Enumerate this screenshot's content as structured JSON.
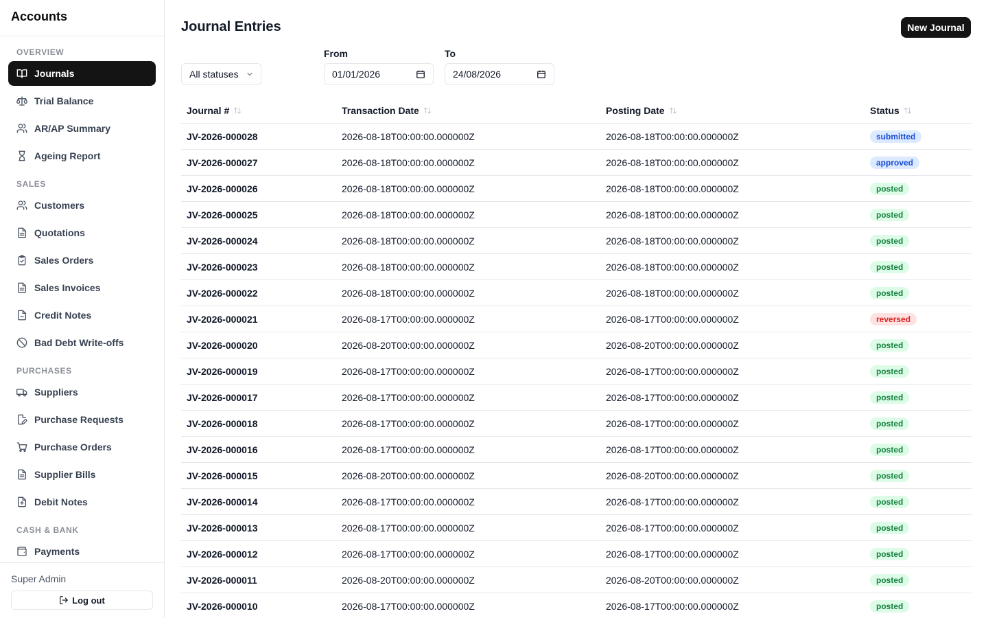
{
  "app": {
    "title": "Accounts"
  },
  "sidebar": {
    "sections": [
      {
        "label": "OVERVIEW",
        "items": [
          {
            "label": "Journals",
            "icon": "book-open-icon",
            "active": true
          },
          {
            "label": "Trial Balance",
            "icon": "scale-icon"
          },
          {
            "label": "AR/AP Summary",
            "icon": "users-icon"
          },
          {
            "label": "Ageing Report",
            "icon": "hourglass-icon"
          }
        ]
      },
      {
        "label": "SALES",
        "items": [
          {
            "label": "Customers",
            "icon": "users-icon"
          },
          {
            "label": "Quotations",
            "icon": "file-text-icon"
          },
          {
            "label": "Sales Orders",
            "icon": "clipboard-check-icon"
          },
          {
            "label": "Sales Invoices",
            "icon": "file-text-icon"
          },
          {
            "label": "Credit Notes",
            "icon": "file-icon"
          },
          {
            "label": "Bad Debt Write-offs",
            "icon": "ban-icon"
          }
        ]
      },
      {
        "label": "PURCHASES",
        "items": [
          {
            "label": "Suppliers",
            "icon": "truck-icon"
          },
          {
            "label": "Purchase Requests",
            "icon": "file-edit-icon"
          },
          {
            "label": "Purchase Orders",
            "icon": "cart-icon"
          },
          {
            "label": "Supplier Bills",
            "icon": "file-text-icon"
          },
          {
            "label": "Debit Notes",
            "icon": "file-plus-icon"
          }
        ]
      },
      {
        "label": "CASH & BANK",
        "items": [
          {
            "label": "Payments",
            "icon": "wallet-icon"
          }
        ]
      }
    ],
    "user": "Super Admin",
    "logout_label": "Log out"
  },
  "header": {
    "title": "Journal Entries",
    "new_button": "New Journal"
  },
  "filters": {
    "status": "All statuses",
    "from_label": "From",
    "from_value": "01/01/2026",
    "to_label": "To",
    "to_value": "24/08/2026"
  },
  "table": {
    "columns": [
      "Journal #",
      "Transaction Date",
      "Posting Date",
      "Status"
    ],
    "rows": [
      [
        "JV-2026-000028",
        "2026-08-18T00:00:00.000000Z",
        "2026-08-18T00:00:00.000000Z",
        "submitted"
      ],
      [
        "JV-2026-000027",
        "2026-08-18T00:00:00.000000Z",
        "2026-08-18T00:00:00.000000Z",
        "approved"
      ],
      [
        "JV-2026-000026",
        "2026-08-18T00:00:00.000000Z",
        "2026-08-18T00:00:00.000000Z",
        "posted"
      ],
      [
        "JV-2026-000025",
        "2026-08-18T00:00:00.000000Z",
        "2026-08-18T00:00:00.000000Z",
        "posted"
      ],
      [
        "JV-2026-000024",
        "2026-08-18T00:00:00.000000Z",
        "2026-08-18T00:00:00.000000Z",
        "posted"
      ],
      [
        "JV-2026-000023",
        "2026-08-18T00:00:00.000000Z",
        "2026-08-18T00:00:00.000000Z",
        "posted"
      ],
      [
        "JV-2026-000022",
        "2026-08-18T00:00:00.000000Z",
        "2026-08-18T00:00:00.000000Z",
        "posted"
      ],
      [
        "JV-2026-000021",
        "2026-08-17T00:00:00.000000Z",
        "2026-08-17T00:00:00.000000Z",
        "reversed"
      ],
      [
        "JV-2026-000020",
        "2026-08-20T00:00:00.000000Z",
        "2026-08-20T00:00:00.000000Z",
        "posted"
      ],
      [
        "JV-2026-000019",
        "2026-08-17T00:00:00.000000Z",
        "2026-08-17T00:00:00.000000Z",
        "posted"
      ],
      [
        "JV-2026-000017",
        "2026-08-17T00:00:00.000000Z",
        "2026-08-17T00:00:00.000000Z",
        "posted"
      ],
      [
        "JV-2026-000018",
        "2026-08-17T00:00:00.000000Z",
        "2026-08-17T00:00:00.000000Z",
        "posted"
      ],
      [
        "JV-2026-000016",
        "2026-08-17T00:00:00.000000Z",
        "2026-08-17T00:00:00.000000Z",
        "posted"
      ],
      [
        "JV-2026-000015",
        "2026-08-20T00:00:00.000000Z",
        "2026-08-20T00:00:00.000000Z",
        "posted"
      ],
      [
        "JV-2026-000014",
        "2026-08-17T00:00:00.000000Z",
        "2026-08-17T00:00:00.000000Z",
        "posted"
      ],
      [
        "JV-2026-000013",
        "2026-08-17T00:00:00.000000Z",
        "2026-08-17T00:00:00.000000Z",
        "posted"
      ],
      [
        "JV-2026-000012",
        "2026-08-17T00:00:00.000000Z",
        "2026-08-17T00:00:00.000000Z",
        "posted"
      ],
      [
        "JV-2026-000011",
        "2026-08-20T00:00:00.000000Z",
        "2026-08-20T00:00:00.000000Z",
        "posted"
      ],
      [
        "JV-2026-000010",
        "2026-08-17T00:00:00.000000Z",
        "2026-08-17T00:00:00.000000Z",
        "posted"
      ]
    ]
  },
  "colors": {
    "accent": "#141414",
    "border": "#e5e7eb",
    "status_submitted": "#1d4ed8",
    "status_posted": "#15803d",
    "status_reversed": "#dc2626"
  }
}
